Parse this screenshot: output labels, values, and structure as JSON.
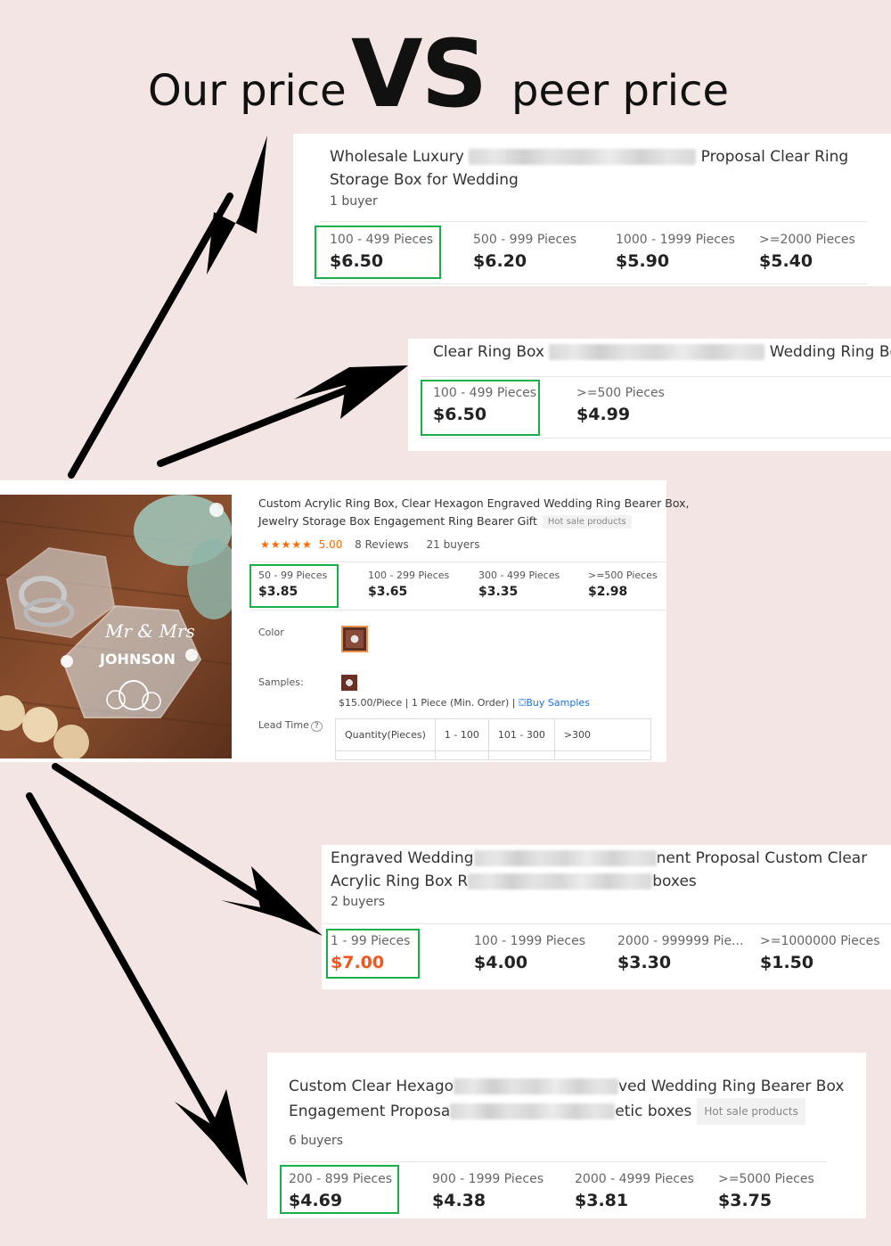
{
  "headline": {
    "left": "Our price",
    "vs": "VS",
    "right": "peer price"
  },
  "card1": {
    "title_a": "Wholesale Luxury",
    "title_b": "Proposal Clear Ring",
    "title_line2": "Storage Box for Wedding",
    "buyers": "1 buyer",
    "tiers": [
      {
        "qty": "100 - 499 Pieces",
        "price": "$6.50"
      },
      {
        "qty": "500 - 999 Pieces",
        "price": "$6.20"
      },
      {
        "qty": "1000 - 1999 Pieces",
        "price": "$5.90"
      },
      {
        "qty": ">=2000 Pieces",
        "price": "$5.40"
      }
    ]
  },
  "card2": {
    "title_a": "Clear Ring Box",
    "title_b": "Wedding Ring Box",
    "tiers": [
      {
        "qty": "100 - 499 Pieces",
        "price": "$6.50"
      },
      {
        "qty": ">=500 Pieces",
        "price": "$4.99"
      }
    ]
  },
  "our": {
    "title_line1": "Custom Acrylic Ring Box, Clear Hexagon Engraved Wedding Ring Bearer Box,",
    "title_line2": "Jewelry Storage Box Engagement Ring Bearer Gift",
    "tag": "Hot sale products",
    "stars": "★★★★★",
    "rating": "5.00",
    "reviews": "8 Reviews",
    "buyers": "21 buyers",
    "tiers": [
      {
        "qty": "50 - 99 Pieces",
        "price": "$3.85"
      },
      {
        "qty": "100 - 299 Pieces",
        "price": "$3.65"
      },
      {
        "qty": "300 - 499 Pieces",
        "price": "$3.35"
      },
      {
        "qty": ">=500 Pieces",
        "price": "$2.98"
      }
    ],
    "color_label": "Color",
    "samples_label": "Samples:",
    "samples_text": "$15.00/Piece | 1 Piece (Min. Order) |",
    "buy_samples": "Buy Samples",
    "lead_label": "Lead Time",
    "lead_headers": [
      "Quantity(Pieces)",
      "1 - 100",
      "101 - 300",
      ">300"
    ],
    "photo_text_top": "Mr & Mrs",
    "photo_text_name": "JOHNSON"
  },
  "card3": {
    "title_a": "Engraved Wedding",
    "title_b": "nent Proposal Custom Clear",
    "title_c": "Acrylic Ring Box R",
    "title_d": "boxes",
    "buyers": "2 buyers",
    "tiers": [
      {
        "qty": "1 - 99 Pieces",
        "price": "$7.00"
      },
      {
        "qty": "100 - 1999 Pieces",
        "price": "$4.00"
      },
      {
        "qty": "2000 - 999999 Pie...",
        "price": "$3.30"
      },
      {
        "qty": ">=1000000 Pieces",
        "price": "$1.50"
      }
    ]
  },
  "card4": {
    "title_a": "Custom Clear Hexago",
    "title_b": "ved Wedding Ring Bearer Box",
    "title_c": "Engagement Proposa",
    "title_d": "etic boxes",
    "tag": "Hot sale products",
    "buyers": "6 buyers",
    "tiers": [
      {
        "qty": "200 - 899 Pieces",
        "price": "$4.69"
      },
      {
        "qty": "900 - 1999 Pieces",
        "price": "$4.38"
      },
      {
        "qty": "2000 - 4999 Pieces",
        "price": "$3.81"
      },
      {
        "qty": ">=5000 Pieces",
        "price": "$3.75"
      }
    ]
  },
  "colors": {
    "background": "#f3e5e3",
    "highlight": "#17b04a",
    "accent_orange": "#f0561d",
    "star": "#ff6a00"
  }
}
